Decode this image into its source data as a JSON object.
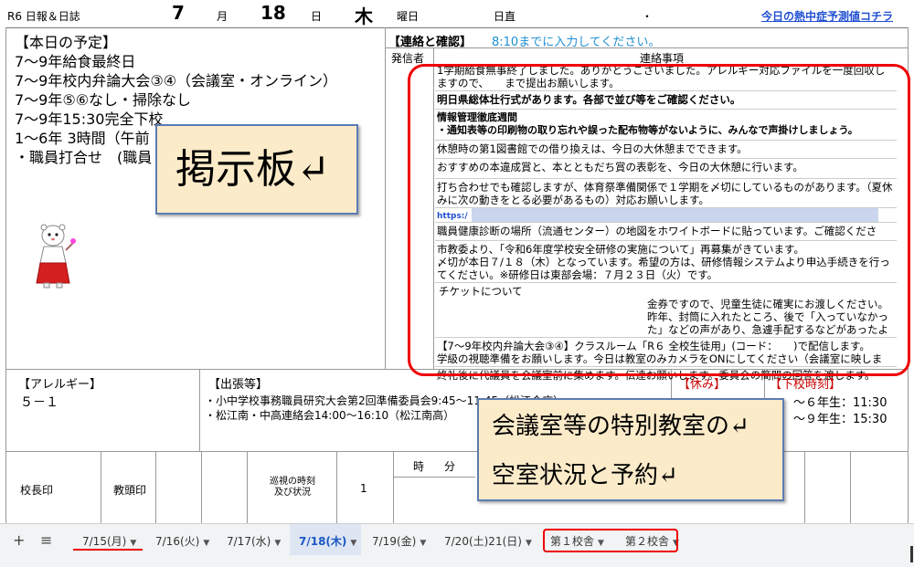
{
  "header": {
    "title": "R6 日報＆日誌",
    "month": "7",
    "month_unit": "月",
    "day": "18",
    "day_unit": "日",
    "weekday": "木",
    "weekday_label": "曜日",
    "duty_label": "日直",
    "dot": "・",
    "heat_link": "今日の熱中症予測値コチラ"
  },
  "schedule": {
    "lines": [
      "【本日の予定】",
      "7～9年給食最終日",
      "7～9年校内弁論大会③④（会議室・オンライン）",
      "7～9年⑤⑥なし・掃除なし",
      "7～9年15:30完全下校",
      "1～6年 3時間（午前",
      "・職員打合せ　(職員"
    ]
  },
  "renraku": {
    "title": "【連絡と確認】",
    "note": "8:10までに入力してください。",
    "col_sender": "発信者",
    "col_content": "連絡事項",
    "messages": [
      "1学期給食無事終了しました。ありがとうございました。アレルギー対応ファイルを一度回収しますので、　　まで提出お願いします。",
      "明日県総体壮行式があります。各部で並び等をご確認ください。",
      "情報管理徹底週間\n・通知表等の印刷物の取り忘れや誤った配布物等がないように、みんなで声掛けしましょう。",
      "休憩時の第1図書館での借り換えは、今日の大休憩までできます。",
      "おすすめの本違成賞と、本とともだち賞の表彰を、今日の大休憩に行います。",
      "打ち合わせでも確認しますが、体育祭準備関係で１学期を〆切にしているものがあります。（夏休みに次の動きをとる必要があるもの）対応お願いします。",
      "https:/",
      "職員健康診断の場所（流通センター）の地図をホワイトボードに貼っています。ご確認ください。",
      "市教委より、「令和6年度学校安全研修の実施について」再募集がきています。\n〆切が本日７/１８（木）となっています。希望の方は、研修情報システムより申込手続きを行ってください。※研修日は東部会場：７月２３日（火）です。",
      "チケットについて\n金券ですので、児童生徒に確実にお渡しください。昨年、封筒に入れたところ、後で「入っていなかった」などの声があり、急遽手配するなどがあったようです。その場で確実に渡すほうが後々のトラブルがないと思います。※スクールメールも本日流します。",
      "【7～9年校内弁論大会③④】クラスルーム「R６ 全校生徒用」(コード：　　)で配信します。\n学級の視聴準備をお願いします。今日は教室のみカメラをONにしてください（会議室に映します）。",
      "終礼後に代議員を会議室前に集めます。伝達お願いします。委員会の簡問の回答を渡します。"
    ]
  },
  "allergy": {
    "label": "【アレルギー】",
    "value": "５－１"
  },
  "trip": {
    "label": "【出張等】",
    "items": [
      "・小中学校事務職員研究大会第2回準備委員会9:45～11:45（松江合庁）",
      "・松江南・中高連絡会14:00～16:10（松江南高）"
    ]
  },
  "rest": {
    "label": "【休み】"
  },
  "dismissal": {
    "label": "【下校時刻】",
    "line1": "～６年生：11:30",
    "line2": "～９年生：15:30"
  },
  "stamps": {
    "principal": "校長印",
    "vice": "教頭印",
    "patrol": "巡視の時刻\n及び状況",
    "one": "1",
    "hour": "時",
    "minute": "分"
  },
  "callouts": {
    "board": "掲示板↵",
    "room_line1": "会議室等の特別教室の↵",
    "room_line2": "空室状況と予約↵"
  },
  "tabs": {
    "add_icon": "+",
    "menu_icon": "≡",
    "items": [
      "7/15(月)",
      "7/16(火)",
      "7/17(水)",
      "7/18(木)",
      "7/19(金)",
      "7/20(土)21(日)",
      "第１校舎",
      "第２校舎"
    ],
    "active": "7/18(木)"
  },
  "colors": {
    "highlight_red": "#e00000",
    "link_blue": "#1f4fd1",
    "callout_fill": "#fcebc9",
    "active_tab": "#1a57c4"
  }
}
